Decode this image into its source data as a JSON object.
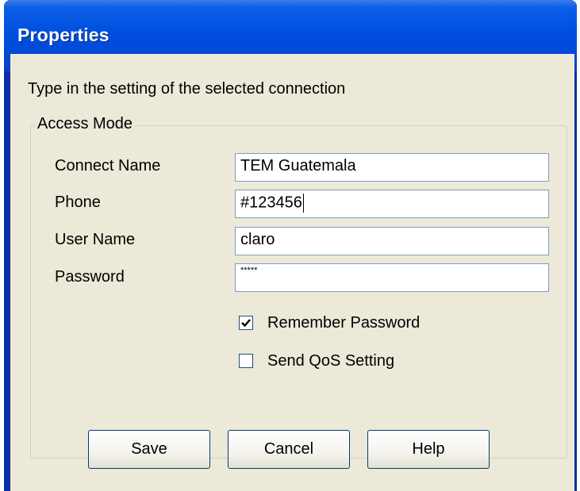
{
  "window": {
    "title": "Properties"
  },
  "dialog": {
    "instruction": "Type in the setting of the selected connection",
    "group_title": "Access Mode",
    "fields": [
      {
        "label": "Connect Name",
        "value": "TEM Guatemala"
      },
      {
        "label": "Phone",
        "value": "#123456"
      },
      {
        "label": "User Name",
        "value": "claro"
      },
      {
        "label": "Password",
        "value": "*****"
      }
    ],
    "checkboxes": [
      {
        "label": "Remember Password",
        "checked": true
      },
      {
        "label": "Send QoS Setting",
        "checked": false
      }
    ],
    "buttons": {
      "save": "Save",
      "cancel": "Cancel",
      "help": "Help"
    }
  },
  "colors": {
    "titlebar": "#0050e0",
    "dialog_bg": "#ece9d8",
    "input_border": "#7f9db9",
    "checkbox_border": "#1c5180"
  }
}
